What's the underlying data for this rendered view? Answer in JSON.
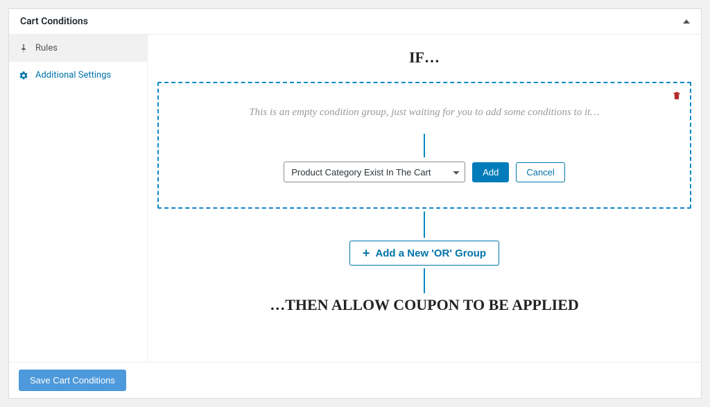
{
  "panel": {
    "title": "Cart Conditions"
  },
  "sidebar": {
    "items": [
      {
        "label": "Rules"
      },
      {
        "label": "Additional Settings"
      }
    ]
  },
  "headings": {
    "if": "IF…",
    "then": "…THEN ALLOW COUPON TO BE APPLIED"
  },
  "group": {
    "empty_msg": "This is an empty condition group, just waiting for you to add some conditions to it…",
    "select_value": "Product Category Exist In The Cart",
    "add_label": "Add",
    "cancel_label": "Cancel"
  },
  "or_button": {
    "label": "Add a New 'OR' Group"
  },
  "footer": {
    "save_label": "Save Cart Conditions"
  }
}
